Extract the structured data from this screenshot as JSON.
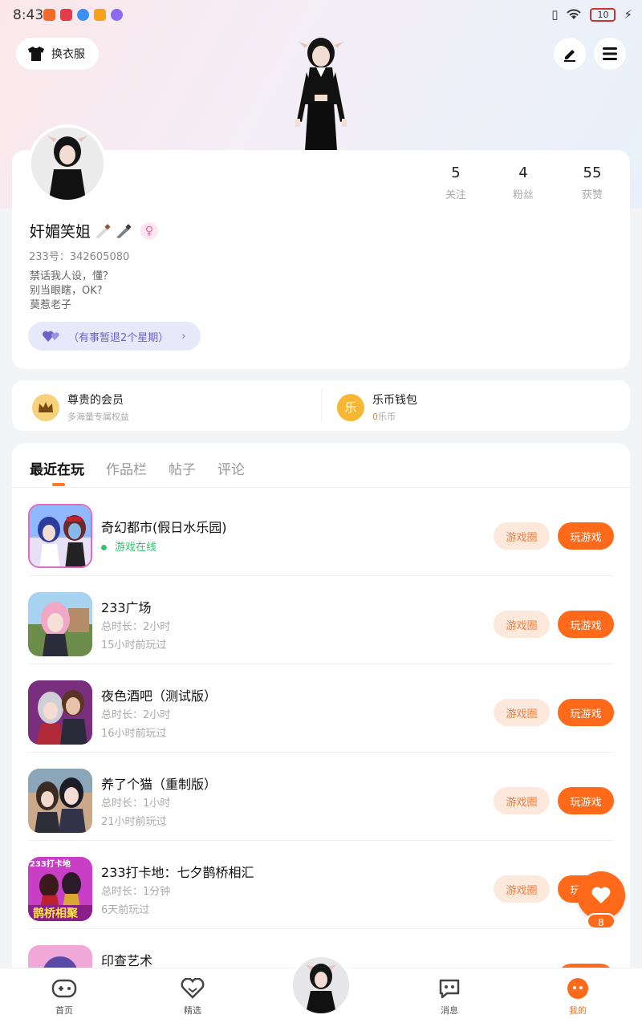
{
  "status_bar": {
    "time": "8:43",
    "battery": "10"
  },
  "header": {
    "outfit_label": "换衣服"
  },
  "profile": {
    "nickname": "奸媚笑姐",
    "uid": "233号：342605080",
    "bio": [
      "禁话我人设，懂？",
      "别当眼瞎，OK?",
      "莫惹老子"
    ],
    "status_text": "（有事暂退2个星期）",
    "gender_symbol": "♀",
    "stats": [
      {
        "value": "5",
        "label": "关注"
      },
      {
        "value": "4",
        "label": "粉丝"
      },
      {
        "value": "55",
        "label": "获赞"
      }
    ]
  },
  "vip": {
    "member_title": "尊贵的会员",
    "member_sub": "多海量专属权益",
    "wallet_title": "乐币钱包",
    "wallet_amount": "0",
    "wallet_unit": "乐币",
    "wallet_icon_text": "乐"
  },
  "tabs": [
    "最近在玩",
    "作品栏",
    "帖子",
    "评论"
  ],
  "games": [
    {
      "name": "奇幻都市(假日水乐园)",
      "online": "游戏在线",
      "duration": "",
      "last_played": ""
    },
    {
      "name": "233广场",
      "online": "",
      "duration": "总时长：2小时",
      "last_played": "15小时前玩过"
    },
    {
      "name": "夜色酒吧（测试版）",
      "online": "",
      "duration": "总时长：2小时",
      "last_played": "16小时前玩过"
    },
    {
      "name": "养了个猫（重制版）",
      "online": "",
      "duration": "总时长：1小时",
      "last_played": "21小时前玩过"
    },
    {
      "name": "233打卡地：七夕鹊桥相汇",
      "online": "",
      "duration": "总时长：1分钟",
      "last_played": "6天前玩过"
    },
    {
      "name": "印查艺术",
      "online": "",
      "duration": "",
      "last_played": ""
    }
  ],
  "buttons": {
    "circle": "游戏圈",
    "play": "玩游戏"
  },
  "thumb_texts": {
    "tag": "233打卡地",
    "banner": "鹊桥相聚"
  },
  "float_like": {
    "count": "8"
  },
  "bottom_nav": [
    {
      "label": "首页"
    },
    {
      "label": "精选"
    },
    {
      "label": "消息"
    },
    {
      "label": "我的"
    }
  ],
  "colors": {
    "accent": "#ff6a1a",
    "online_green": "#2fc56e"
  }
}
